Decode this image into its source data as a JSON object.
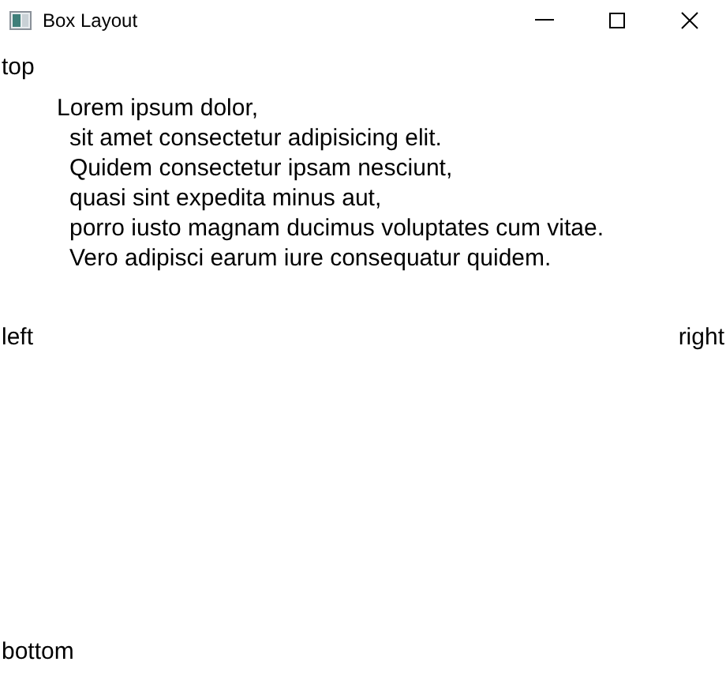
{
  "window": {
    "title": "Box Layout"
  },
  "top_label": "top",
  "paragraph": [
    "Lorem ipsum dolor,",
    "sit amet consectetur adipisicing elit.",
    "Quidem consectetur ipsam nesciunt,",
    "quasi sint expedita minus aut,",
    "porro iusto magnam ducimus voluptates cum vitae.",
    "Vero adipisci earum iure consequatur quidem."
  ],
  "left_label": "left",
  "right_label": "right",
  "bottom_label": "bottom"
}
